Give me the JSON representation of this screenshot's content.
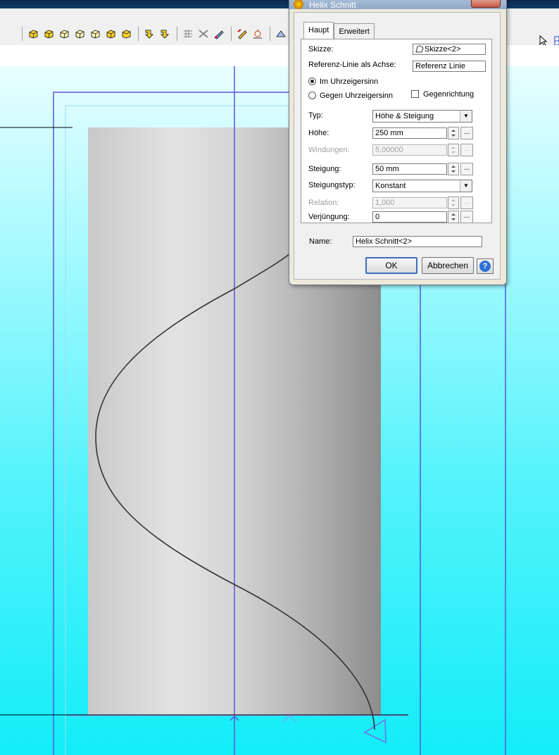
{
  "dialog": {
    "title": "Helix Schnitt",
    "tabs": [
      {
        "label": "Haupt",
        "active": true
      },
      {
        "label": "Erweitert",
        "active": false
      }
    ],
    "skizze": {
      "label": "Skizze:",
      "value": "Skizze<2>"
    },
    "achse": {
      "label": "Referenz-Linie als Achse:",
      "value": "Referenz Linie"
    },
    "richtung": {
      "uhrzeigersinn": "Im Uhrzeigersinn",
      "gegen": "Gegen Uhrzeigersinn",
      "gegenrichtung": "Gegenrichtung",
      "selected": "uhrzeigersinn",
      "gegenrichtung_checked": false
    },
    "typ": {
      "label": "Typ:",
      "value": "Höhe &  Steigung"
    },
    "hoehe": {
      "label": "Höhe:",
      "value": "250 mm"
    },
    "windungen": {
      "label": "Windungen:",
      "value": "5,00000",
      "disabled": true
    },
    "steigung": {
      "label": "Steigung:",
      "value": "50 mm"
    },
    "steigungstyp": {
      "label": "Steigungstyp:",
      "value": "Konstant"
    },
    "relation": {
      "label": "Relation:",
      "value": "1,000",
      "disabled": true
    },
    "verjuengung": {
      "label": "Verjüngung:",
      "value": "0"
    },
    "name": {
      "label": "Name:",
      "value": "Helix Schnitt<2>"
    },
    "ok_label": "OK",
    "cancel_label": "Abbrechen",
    "dots_label": "..."
  },
  "colors": {
    "viewport_top": "#e9feff",
    "viewport_bottom": "#12edf8",
    "construction_line": "#5b55d8",
    "helix_curve": "#333333"
  }
}
